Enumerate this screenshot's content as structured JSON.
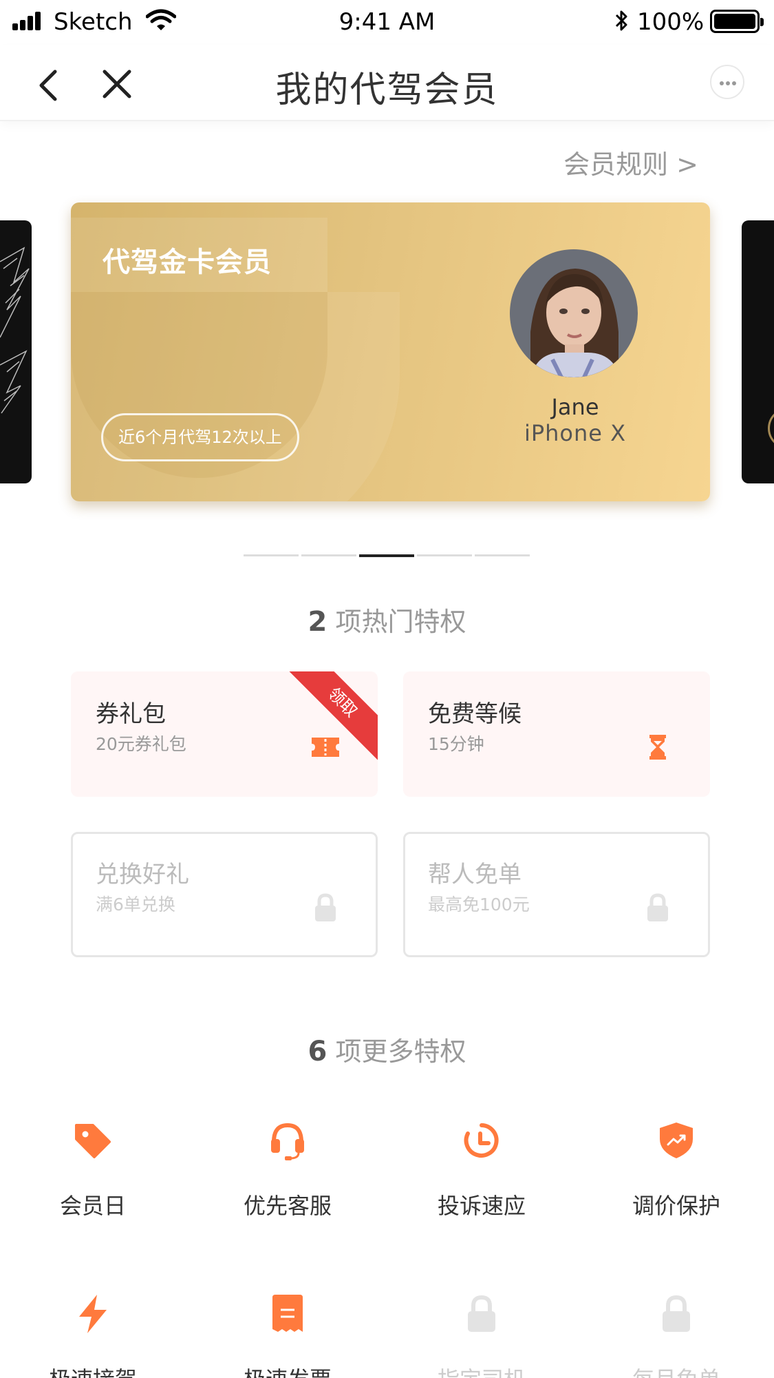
{
  "status_bar": {
    "carrier": "Sketch",
    "time": "9:41 AM",
    "battery": "100%"
  },
  "nav": {
    "title": "我的代驾会员"
  },
  "rules_link": "会员规则 >",
  "card": {
    "tier": "代驾金卡会员",
    "requirement": "近6个月代驾12次以上",
    "user_name": "Jane",
    "device": "iPhone X"
  },
  "carousel": {
    "total_pages": 5,
    "active_page": 3
  },
  "hot_section": {
    "count": "2",
    "label": "项热门特权",
    "tiles": [
      {
        "title": "券礼包",
        "subtitle": "20元券礼包",
        "icon": "ticket-icon",
        "badge": "领取"
      },
      {
        "title": "免费等候",
        "subtitle": "15分钟",
        "icon": "hourglass-icon"
      },
      {
        "title": "兑换好礼",
        "subtitle": "满6单兑换",
        "icon": "lock-icon"
      },
      {
        "title": "帮人免单",
        "subtitle": "最高免100元",
        "icon": "lock-icon"
      }
    ]
  },
  "more_section": {
    "count": "6",
    "label": "项更多特权",
    "perks": [
      {
        "label": "会员日",
        "icon": "tag-icon"
      },
      {
        "label": "优先客服",
        "icon": "headset-icon"
      },
      {
        "label": "投诉速应",
        "icon": "clock-icon"
      },
      {
        "label": "调价保护",
        "icon": "shield-icon"
      },
      {
        "label": "极速接驾",
        "icon": "lightning-icon"
      },
      {
        "label": "极速发票",
        "icon": "receipt-icon"
      },
      {
        "label": "指定司机",
        "icon": "lock-icon"
      },
      {
        "label": "每月免单",
        "icon": "lock-icon"
      }
    ]
  },
  "colors": {
    "accent": "#ff7a3d",
    "gold_start": "#d5b46c",
    "gold_end": "#f6d591",
    "badge_red": "#e63c3c"
  }
}
